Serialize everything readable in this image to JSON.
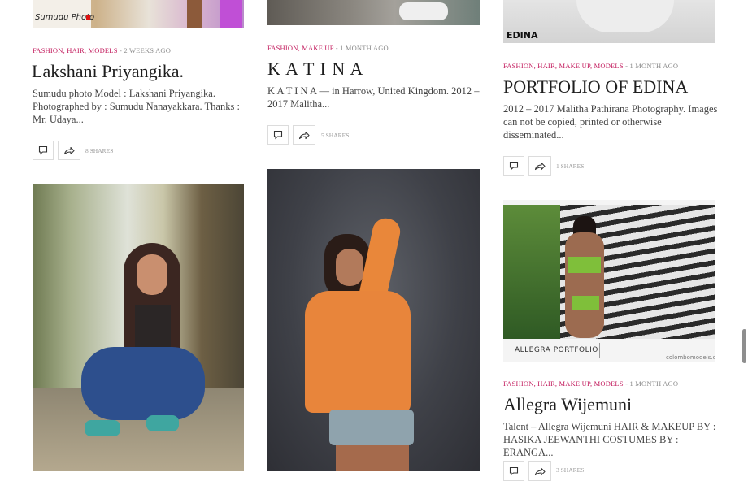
{
  "posts": [
    {
      "categories": "Fashion, Hair, Models",
      "date": "2 weeks ago",
      "title": "Lakshani Priyangika.",
      "excerpt": "Sumudu photo Model : Lakshani Priyangika. Photographed by : Sumudu Nanayakkara. Thanks : Mr. Udaya...",
      "shares": "8 Shares",
      "image_caption": "Sumudu Photo"
    },
    {
      "categories": "Fashion, Make Up",
      "date": "1 month ago",
      "title": "K A T I N A",
      "excerpt": "K A T I N A — in Harrow, United Kingdom. 2012 – 2017 Malitha...",
      "shares": "5 Shares"
    },
    {
      "categories": "Fashion, Hair, Make Up, Models",
      "date": "1 month ago",
      "title": "PORTFOLIO OF EDINA",
      "excerpt": "2012 – 2017 Malitha Pathirana Photography. Images can not be copied, printed or otherwise disseminated...",
      "shares": "1 Shares",
      "image_caption": "EDINA"
    },
    {
      "categories": "Fashion, Hair, Make Up, Models",
      "date": "1 month ago",
      "title": "Allegra Wijemuni",
      "excerpt": "Talent – Allegra Wijemuni HAIR & MAKEUP BY : HASIKA JEEWANTHI COSTUMES BY : ERANGA...",
      "shares": "3 Shares",
      "image_caption": "ALLEGRA PORTFOLIO",
      "image_site": "colombomodels.com"
    }
  ],
  "meta_separator": " - ",
  "icons": {
    "comment": "comment-icon",
    "share": "share-icon"
  },
  "colors": {
    "category": "#c2185b",
    "meta": "#8a8a8a",
    "title": "#1e1e1e"
  }
}
